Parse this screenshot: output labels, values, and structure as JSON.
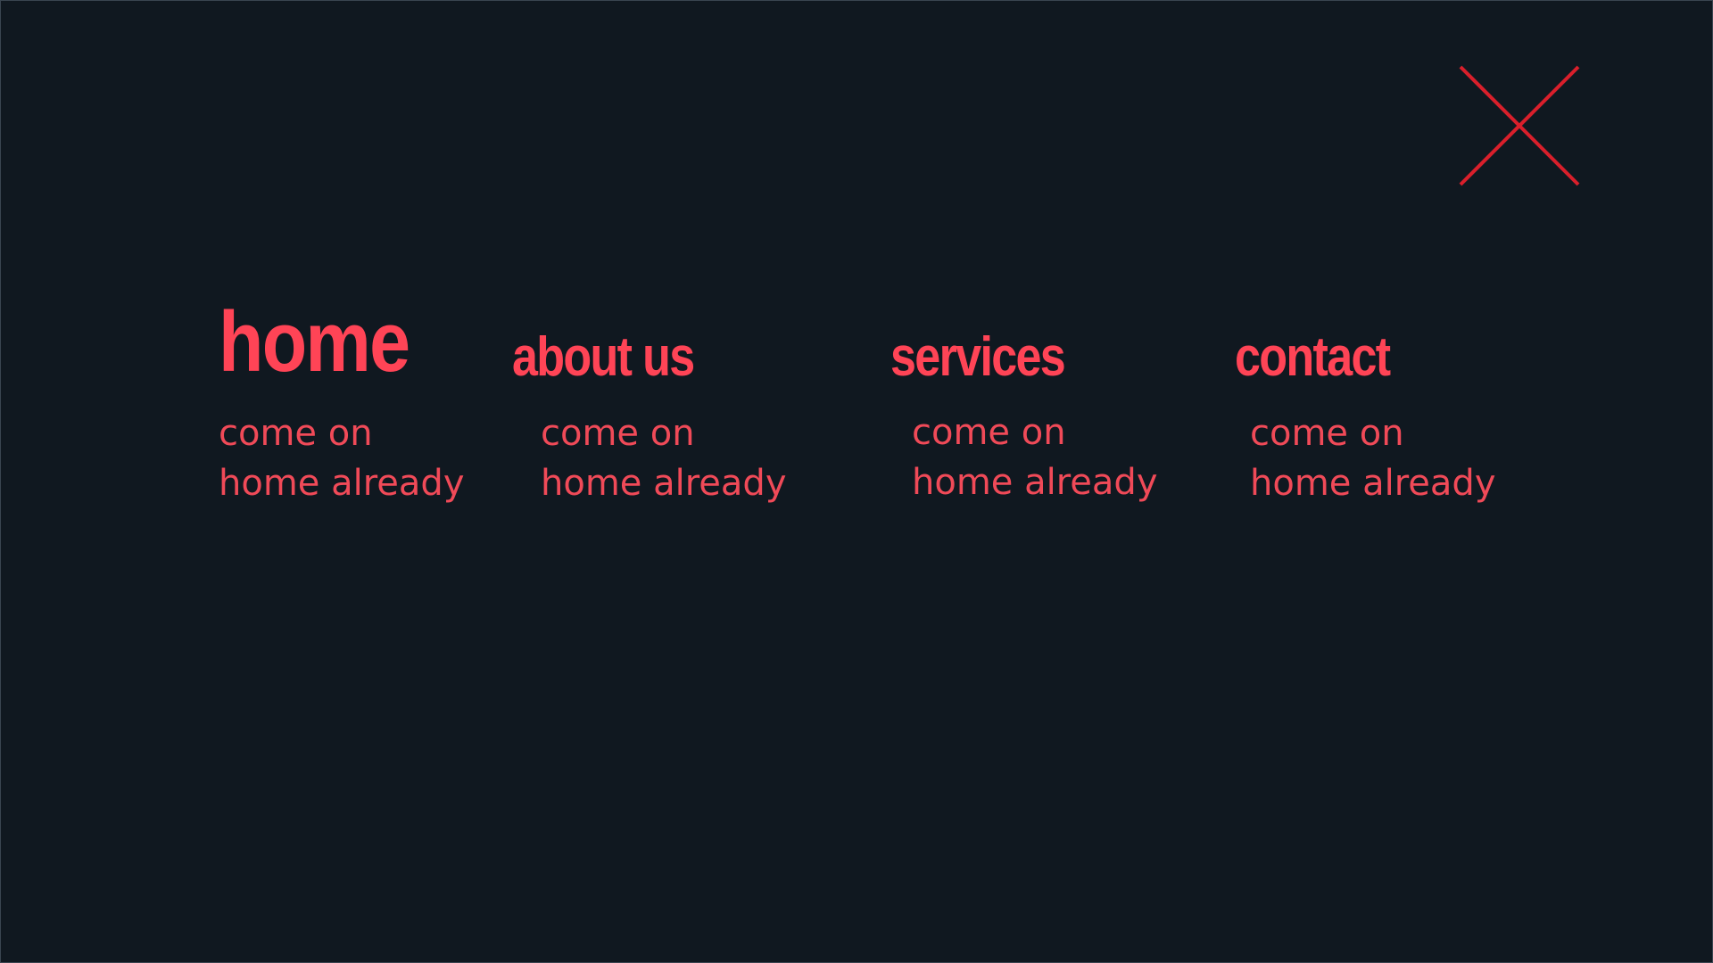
{
  "theme": {
    "background": "#101820",
    "accent": "#ff4456",
    "close_icon_color": "#d91f2b"
  },
  "close_button": {
    "icon": "close-icon"
  },
  "nav": {
    "items": [
      {
        "title": "home",
        "active": true,
        "description_line_1": "come on",
        "description_line_2": "home already"
      },
      {
        "title": "about us",
        "active": false,
        "description_line_1": "come on",
        "description_line_2": "home already"
      },
      {
        "title": "services",
        "active": false,
        "description_line_1": "come on",
        "description_line_2": "home already"
      },
      {
        "title": "contact",
        "active": false,
        "description_line_1": "come on",
        "description_line_2": "home already"
      }
    ]
  }
}
